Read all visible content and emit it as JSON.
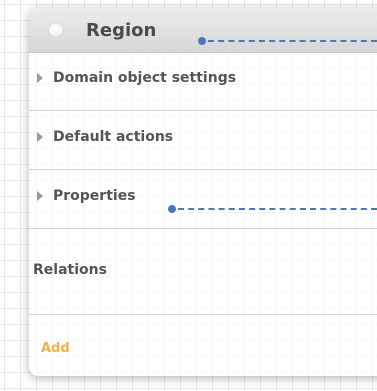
{
  "card": {
    "title": "Region",
    "sections": [
      {
        "label": "Domain object settings"
      },
      {
        "label": "Default actions"
      },
      {
        "label": "Properties"
      }
    ],
    "relations_label": "Relations",
    "add_label": "Add"
  },
  "colors": {
    "accent_orange": "#f5b041",
    "connector_blue": "#4a78b8",
    "header_gray": "#d6d6d6",
    "text_gray": "#555555"
  }
}
